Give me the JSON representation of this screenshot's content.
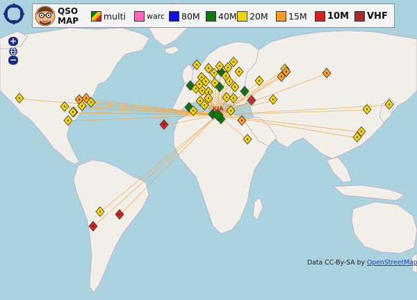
{
  "header": {
    "title_line1": "QSO",
    "title_line2": "MAP"
  },
  "legend": [
    {
      "label": "multi",
      "kind": "multi",
      "name": "legend-multi"
    },
    {
      "label": "warc",
      "color": "#ff66bb",
      "small": true,
      "name": "legend-warc"
    },
    {
      "label": "80M",
      "color": "#1010dd",
      "name": "legend-80m"
    },
    {
      "label": "40M",
      "color": "#0d7a0d",
      "name": "legend-40m"
    },
    {
      "label": "20M",
      "color": "#f2d400",
      "name": "legend-20m"
    },
    {
      "label": "15M",
      "color": "#ff9a22",
      "name": "legend-15m"
    },
    {
      "label": "10M",
      "color": "#d42222",
      "bold": true,
      "name": "legend-10m"
    },
    {
      "label": "VHF",
      "color": "#aa2a2a",
      "bold": true,
      "name": "legend-vhf"
    }
  ],
  "map": {
    "home_label": "KJA",
    "band_colors": {
      "20M": "#f2d400",
      "15M": "#ff9a22",
      "40M": "#0d7a0d",
      "10M": "#d42222",
      "multi": "#cc3333"
    },
    "contacts": [
      {
        "band": "20M",
        "area": "Vancouver"
      },
      {
        "band": "20M",
        "area": "Great Lakes"
      },
      {
        "band": "15M",
        "area": "Ontario"
      },
      {
        "band": "20M",
        "area": "Ontario"
      },
      {
        "band": "20M",
        "area": "New York"
      },
      {
        "band": "15M",
        "area": "Massachusetts"
      },
      {
        "band": "20M",
        "area": "Quebec"
      },
      {
        "band": "20M",
        "area": "US Midwest"
      },
      {
        "band": "20M",
        "area": "US Southeast"
      },
      {
        "band": "10M",
        "area": "Canary Islands"
      },
      {
        "band": "20M",
        "area": "Brazil"
      },
      {
        "band": "10M",
        "area": "Brazil"
      },
      {
        "band": "10M",
        "area": "Argentina"
      },
      {
        "band": "20M",
        "area": "Scandinavia"
      },
      {
        "band": "20M",
        "area": "Sweden"
      },
      {
        "band": "20M",
        "area": "Finland"
      },
      {
        "band": "20M",
        "area": "Russia"
      },
      {
        "band": "15M",
        "area": "Russia"
      },
      {
        "band": "15M",
        "area": "Russia"
      },
      {
        "band": "15M",
        "area": "Siberia"
      },
      {
        "band": "20M",
        "area": "Ukraine"
      },
      {
        "band": "20M",
        "area": "Egypt"
      },
      {
        "band": "15M",
        "area": "Turkey"
      },
      {
        "band": "20M",
        "area": "Kazakhstan"
      },
      {
        "band": "20M",
        "area": "China"
      },
      {
        "band": "20M",
        "area": "China"
      },
      {
        "band": "20M",
        "area": "Japan"
      },
      {
        "band": "20M",
        "area": "Korea"
      },
      {
        "band": "40M",
        "area": "Italy"
      },
      {
        "band": "40M",
        "area": "Tunisia"
      },
      {
        "band": "multi",
        "area": "Greece"
      }
    ]
  },
  "controls": {
    "zoom_in": "+",
    "zoom_out": "−"
  },
  "attribution": {
    "prefix": "Data CC-By-SA by ",
    "link": "OpenStreetMap"
  }
}
